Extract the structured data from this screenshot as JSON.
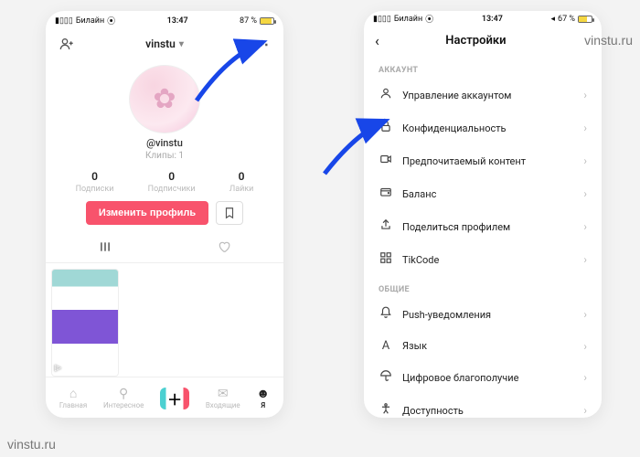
{
  "status": {
    "carrier": "Билайн",
    "time": "13:47",
    "battery": "87 %"
  },
  "status2": {
    "carrier": "Билайн",
    "time": "13:47",
    "battery": "67 %"
  },
  "p1": {
    "username": "vinstu",
    "handle": "@vinstu",
    "clips": "Клипы: 1",
    "stats": [
      {
        "num": "0",
        "label": "Подписки"
      },
      {
        "num": "0",
        "label": "Подписчики"
      },
      {
        "num": "0",
        "label": "Лайки"
      }
    ],
    "edit_btn": "Изменить профиль",
    "nav": [
      "Главная",
      "Интересное",
      "",
      "Входящие",
      "Я"
    ]
  },
  "p2": {
    "title": "Настройки",
    "sections": {
      "account_label": "АККАУНТ",
      "account": [
        {
          "icon": "person",
          "label": "Управление аккаунтом"
        },
        {
          "icon": "lock",
          "label": "Конфиденциальность"
        },
        {
          "icon": "video",
          "label": "Предпочитаемый контент"
        },
        {
          "icon": "wallet",
          "label": "Баланс"
        },
        {
          "icon": "share",
          "label": "Поделиться профилем"
        },
        {
          "icon": "qr",
          "label": "TikCode"
        }
      ],
      "general_label": "ОБЩИЕ",
      "general": [
        {
          "icon": "bell",
          "label": "Push-уведомления"
        },
        {
          "icon": "globe",
          "label": "Язык"
        },
        {
          "icon": "umbrella",
          "label": "Цифровое благополучие"
        },
        {
          "icon": "access",
          "label": "Доступность"
        }
      ]
    }
  },
  "watermark": "vinstu.ru"
}
